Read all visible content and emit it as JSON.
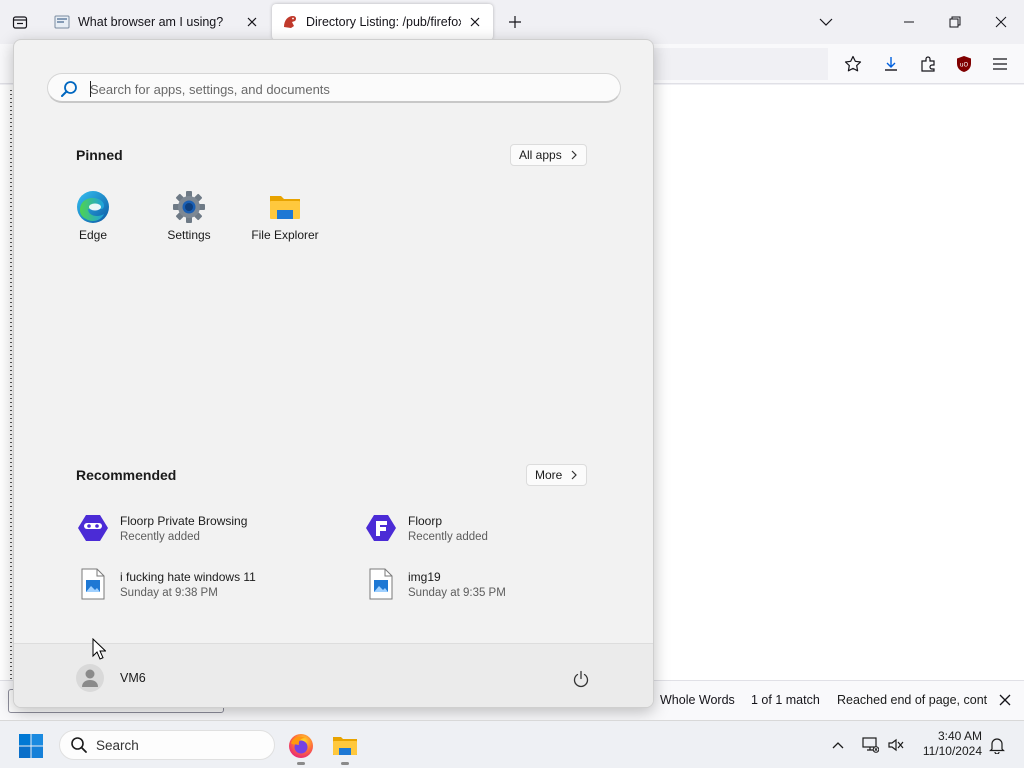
{
  "browser": {
    "tabs": [
      {
        "title": "What browser am I using?",
        "active": false
      },
      {
        "title": "Directory Listing: /pub/firefox/r",
        "active": true
      }
    ]
  },
  "findbar": {
    "whole_words": "Whole Words",
    "match_count": "1 of 1 match",
    "status": "Reached end of page, continued from top"
  },
  "start_menu": {
    "search_placeholder": "Search for apps, settings, and documents",
    "pinned": {
      "title": "Pinned",
      "all_apps_label": "All apps",
      "apps": [
        {
          "label": "Edge",
          "icon": "edge-icon"
        },
        {
          "label": "Settings",
          "icon": "settings-gear-icon"
        },
        {
          "label": "File Explorer",
          "icon": "folder-icon"
        }
      ]
    },
    "recommended": {
      "title": "Recommended",
      "more_label": "More",
      "items": [
        {
          "name": "Floorp Private Browsing",
          "sub": "Recently added",
          "icon": "floorp-private-icon"
        },
        {
          "name": "Floorp",
          "sub": "Recently added",
          "icon": "floorp-icon"
        },
        {
          "name": "i fucking hate windows 11",
          "sub": "Sunday at 9:38 PM",
          "icon": "image-file-icon"
        },
        {
          "name": "img19",
          "sub": "Sunday at 9:35 PM",
          "icon": "image-file-icon"
        }
      ]
    },
    "user": {
      "name": "VM6"
    }
  },
  "taskbar": {
    "search_label": "Search",
    "time": "3:40 AM",
    "date": "11/10/2024"
  },
  "colors": {
    "accent": "#0067c0",
    "ublock": "#800000",
    "floorp": "#4b2bd6"
  }
}
